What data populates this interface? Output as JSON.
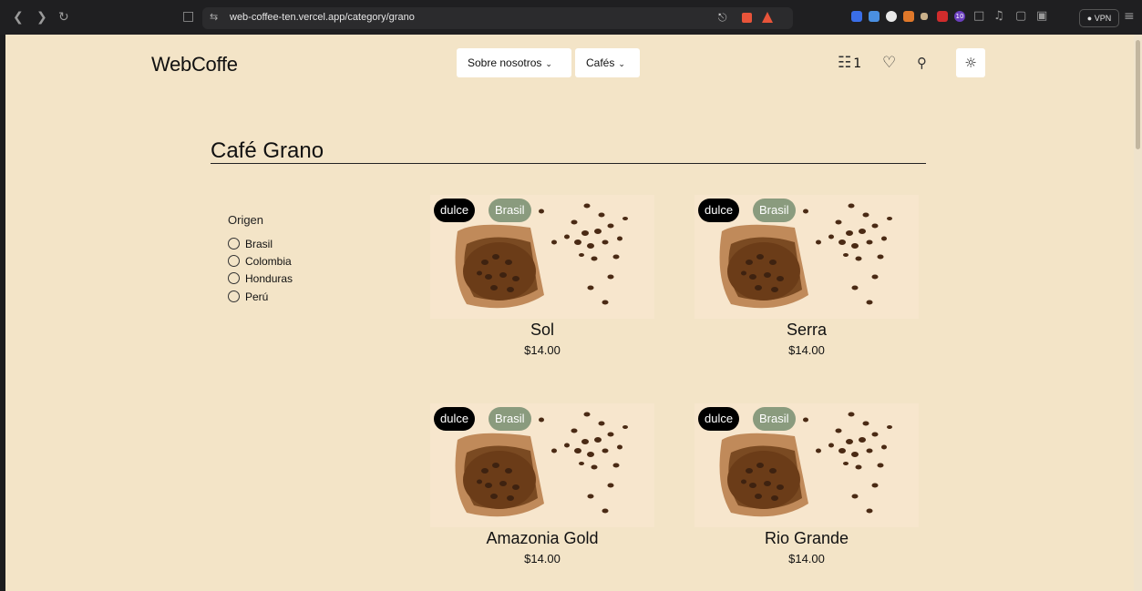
{
  "browser": {
    "url": "web-coffee-ten.vercel.app/category/grano",
    "vpn_label": "VPN",
    "ext_badge": "10"
  },
  "header": {
    "logo": "WebCoffe",
    "menu": [
      {
        "label": "Sobre nosotros"
      },
      {
        "label": "Cafés"
      }
    ],
    "cart_count": "1"
  },
  "page": {
    "title": "Café Grano"
  },
  "filters": {
    "heading": "Origen",
    "options": [
      {
        "label": "Brasil"
      },
      {
        "label": "Colombia"
      },
      {
        "label": "Honduras"
      },
      {
        "label": "Perú"
      }
    ]
  },
  "products": [
    {
      "name": "Sol",
      "price": "$14.00",
      "tag": "dulce",
      "origin": "Brasil"
    },
    {
      "name": "Serra",
      "price": "$14.00",
      "tag": "dulce",
      "origin": "Brasil"
    },
    {
      "name": "Amazonia Gold",
      "price": "$14.00",
      "tag": "dulce",
      "origin": "Brasil"
    },
    {
      "name": "Rio Grande",
      "price": "$14.00",
      "tag": "dulce",
      "origin": "Brasil"
    }
  ],
  "colors": {
    "page_bg": "#f3e4c7",
    "tag_dark": "#000000",
    "tag_origin": "#8a9b7e"
  }
}
